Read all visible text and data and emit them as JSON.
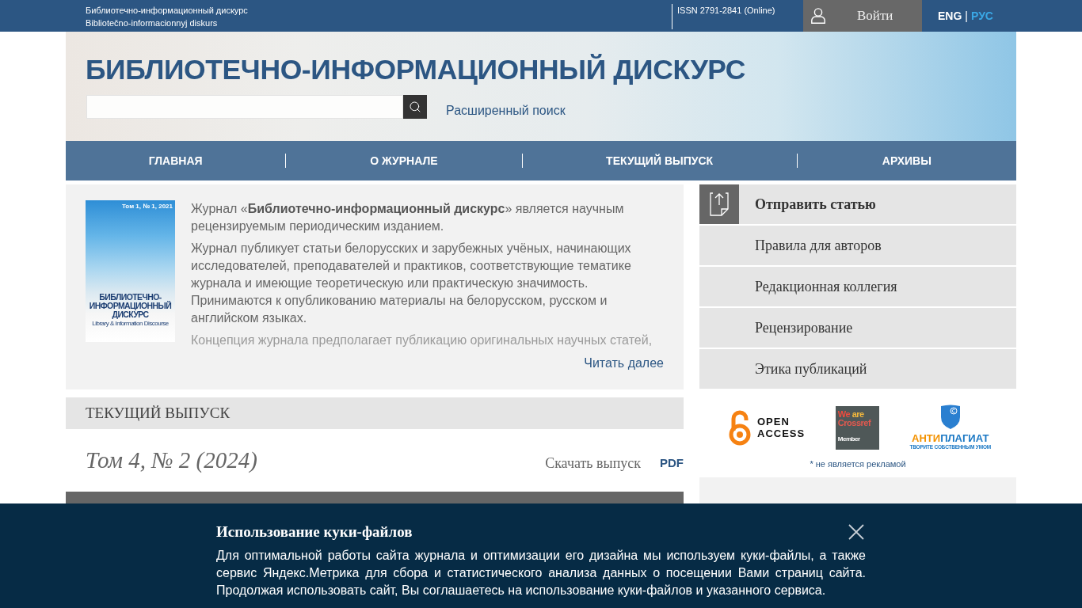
{
  "top_bar": {
    "site_name": "Библиотечно-информационный дискурс",
    "site_name_latin": "Bibliotečno-informacionnyj diskurs",
    "issn": "ISSN 2791-2841 (Online)",
    "login": "Войти",
    "languages": [
      {
        "label": "ENG",
        "selected": false
      },
      {
        "label": "РУС",
        "selected": true
      }
    ],
    "language_separator": "|"
  },
  "header": {
    "title": "БИБЛИОТЕЧНО-ИНФОРМАЦИОННЫЙ ДИСКУРС",
    "advanced_search": "Расширенный поиск"
  },
  "nav": [
    "ГЛАВНАЯ",
    "О ЖУРНАЛЕ",
    "ТЕКУЩИЙ ВЫПУСК",
    "АРХИВЫ"
  ],
  "about": {
    "cover": {
      "issue": "Том 1, № 1, 2021",
      "title": "БИБЛИОТЕЧНО-ИНФОРМАЦИОННЫЙ ДИСКУРС",
      "subtitle": "Library & Information Discourse"
    },
    "paragraphs": [
      "Журнал «**Библиотечно-информационный дискурс**» является научным рецензируемым периодическим изданием.",
      "Журнал публикует статьи белорусских и зарубежных учёных, начинающих исследователей, преподавателей и практиков, соответствующие тематике журнала и имеющие теоретическую или практическую значимость. Принимаются к опубликованию материалы на белорусском, русском и английском языках."
    ],
    "faded_line": "Концепция журнала предполагает публикацию оригинальных научных статей,",
    "read_more": "Читать далее"
  },
  "current_issue": {
    "heading": "ТЕКУЩИЙ ВЫПУСК",
    "volume": "Том 4, № 2 (2024)",
    "download_label": "Скачать выпуск",
    "download_format": "PDF"
  },
  "sidebar": {
    "menu": [
      {
        "kind": "submit",
        "label": "Отправить статью"
      },
      {
        "kind": "link",
        "label": "Правила для авторов"
      },
      {
        "kind": "link",
        "label": "Редакционная коллегия"
      },
      {
        "kind": "link",
        "label": "Рецензирование"
      },
      {
        "kind": "link",
        "label": "Этика публикаций"
      }
    ],
    "logos": [
      {
        "kind": "open_access",
        "text": "OPEN ACCESS"
      },
      {
        "kind": "crossref",
        "lines": [
          "**We** are",
          "Crossref",
          "Member"
        ]
      },
      {
        "kind": "antiplagiat",
        "wordmark": "**АНТИ**ПЛАГИАТ",
        "tagline": "ТВОРИТЕ СОБСТВЕННЫМ УМОМ"
      }
    ],
    "disclaimer": "* не является рекламой"
  },
  "cookie_banner": {
    "title": "Использование куки-файлов",
    "text": "Для оптимальной работы сайта журнала и оптимизации его дизайна мы используем куки-файлы, а также сервис Яндекс.Метрика для сбора и статистического анализа данных о посещении Вами страниц сайта. Продолжая использовать сайт, Вы соглашаетесь на использование куки-файлов и указанного сервиса."
  }
}
